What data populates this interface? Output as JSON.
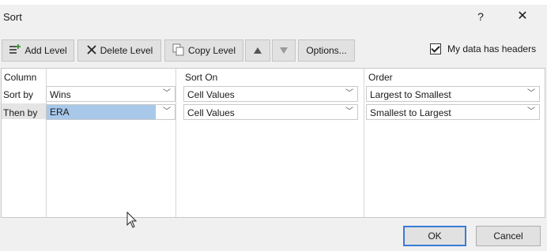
{
  "dialog": {
    "title": "Sort",
    "help_glyph": "?",
    "close_glyph": "✕"
  },
  "toolbar": {
    "add_level": "Add Level",
    "delete_level": "Delete Level",
    "copy_level": "Copy Level",
    "options": "Options...",
    "my_data_has_headers": "My data has headers",
    "headers_checked": true
  },
  "grid": {
    "headers": {
      "column": "Column",
      "sort_on": "Sort On",
      "order": "Order"
    },
    "rows": [
      {
        "label": "Sort by",
        "column": "Wins",
        "sort_on": "Cell Values",
        "order": "Largest to Smallest"
      },
      {
        "label": "Then by",
        "column": "ERA",
        "sort_on": "Cell Values",
        "order": "Smallest to Largest"
      }
    ]
  },
  "footer": {
    "ok": "OK",
    "cancel": "Cancel"
  },
  "icons": {
    "add_level": "add-level-icon",
    "delete_level": "x-icon",
    "copy_level": "copy-icon",
    "move_up": "triangle-up-icon",
    "move_down": "triangle-down-icon",
    "dropdown": "chevron-down-icon"
  },
  "colors": {
    "ok_border": "#3b7ad8",
    "selection": "#a8c8ea"
  }
}
